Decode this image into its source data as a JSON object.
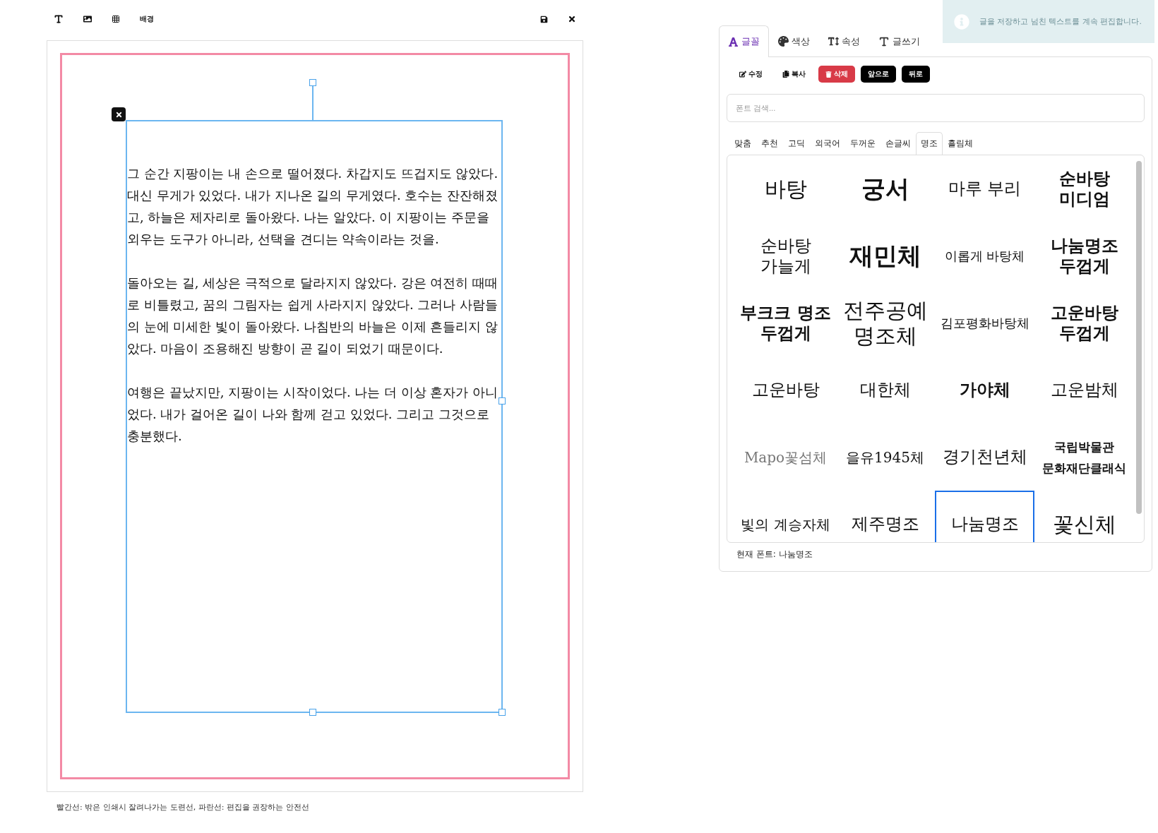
{
  "toolbar": {
    "tools": [
      {
        "kind": "text"
      },
      {
        "kind": "image"
      },
      {
        "kind": "grid"
      },
      {
        "kind": "label",
        "label": "배경"
      }
    ],
    "actions": [
      {
        "kind": "save"
      },
      {
        "kind": "close"
      }
    ]
  },
  "canvas": {
    "paragraphs": [
      "그 순간 지팡이는 내 손으로 떨어졌다. 차갑지도 뜨겁지도 않았다. 대신 무게가 있었다. 내가 지나온 길의 무게였다. 호수는 잔잔해졌고, 하늘은 제자리로 돌아왔다. 나는 알았다. 이 지팡이는 주문을 외우는 도구가 아니라, 선택을 견디는 약속이라는 것을.",
      "돌아오는 길, 세상은 극적으로 달라지지 않았다. 강은 여전히 때때로 비틀렸고, 꿈의 그림자는 쉽게 사라지지 않았다. 그러나 사람들의 눈에 미세한 빛이 돌아왔다. 나침반의 바늘은 이제 흔들리지 않았다. 마음이 조용해진 방향이 곧 길이 되었기 때문이다.",
      "여행은 끝났지만, 지팡이는 시작이었다. 나는 더 이상 혼자가 아니었다. 내가 걸어온 길이 나와 함께 걷고 있었다. 그리고 그것으로 충분했다."
    ]
  },
  "caption": "빨간선: 밖은 인쇄시 잘려나가는 도련선, 파란선: 편집을 권장하는 안전선",
  "toast": {
    "message": "글을 저장하고 넘친 텍스트를 계속 편집합니다."
  },
  "tabs": [
    {
      "kind": "font",
      "label": "글꼴",
      "selected": true
    },
    {
      "kind": "color",
      "label": "색상",
      "selected": false
    },
    {
      "kind": "size",
      "label": "속성",
      "selected": false
    },
    {
      "kind": "write",
      "label": "글쓰기",
      "selected": false
    }
  ],
  "buttons": [
    {
      "kind": "edit",
      "label": "수정"
    },
    {
      "kind": "copy",
      "label": "복사"
    },
    {
      "kind": "delete",
      "label": "삭제"
    },
    {
      "kind": "dark",
      "label": "앞으로"
    },
    {
      "kind": "dark",
      "label": "뒤로"
    }
  ],
  "search": {
    "placeholder": "폰트 검색..."
  },
  "categories": [
    {
      "label": "맞춤",
      "selected": false
    },
    {
      "label": "추천",
      "selected": false
    },
    {
      "label": "고딕",
      "selected": false
    },
    {
      "label": "외국어",
      "selected": false
    },
    {
      "label": "두꺼운",
      "selected": false
    },
    {
      "label": "손글씨",
      "selected": false
    },
    {
      "label": "명조",
      "selected": true
    },
    {
      "label": "흘림체",
      "selected": false
    }
  ],
  "fonts": [
    {
      "name": "바탕",
      "kind": "large",
      "selected": false
    },
    {
      "name": "궁서",
      "kind": "heavy",
      "selected": false
    },
    {
      "name": "마루 부리",
      "kind": "medium",
      "selected": false
    },
    {
      "name": "순바탕 미디엄",
      "kind": "bold",
      "selected": false
    },
    {
      "name": "순바탕 가늘게",
      "kind": "medium",
      "selected": false
    },
    {
      "name": "재민체",
      "kind": "heavy",
      "selected": false
    },
    {
      "name": "이롭게 바탕체",
      "kind": "small",
      "selected": false
    },
    {
      "name": "나눔명조 두껍게",
      "kind": "bold",
      "selected": false
    },
    {
      "name": "부크크 명조 두껍게",
      "kind": "bold",
      "selected": false
    },
    {
      "name": "전주공예 명조체",
      "kind": "large",
      "selected": false
    },
    {
      "name": "김포평화바탕체",
      "kind": "small",
      "selected": false
    },
    {
      "name": "고운바탕 두껍게",
      "kind": "bold",
      "selected": false
    },
    {
      "name": "고운바탕",
      "kind": "medium",
      "selected": false
    },
    {
      "name": "대한체",
      "kind": "medium",
      "selected": false
    },
    {
      "name": "가야체",
      "kind": "bold",
      "selected": false
    },
    {
      "name": "고운밤체",
      "kind": "medium",
      "selected": false
    },
    {
      "name": "Mapo꽃섬체",
      "kind": "light",
      "selected": false
    },
    {
      "name": "을유1945체",
      "kind": "regular",
      "selected": false
    },
    {
      "name": "경기천년체",
      "kind": "medium",
      "selected": false
    },
    {
      "name": "국립박물관 문화재단클래식",
      "kind": "smallbold",
      "selected": false
    },
    {
      "name": "빛의 계승자체",
      "kind": "regular",
      "selected": false
    },
    {
      "name": "제주명조",
      "kind": "medium",
      "selected": false
    },
    {
      "name": "나눔명조",
      "kind": "medium",
      "selected": true
    },
    {
      "name": "꽃신체",
      "kind": "large",
      "selected": false
    }
  ],
  "current_font": "현재 폰트: 나눔명조"
}
